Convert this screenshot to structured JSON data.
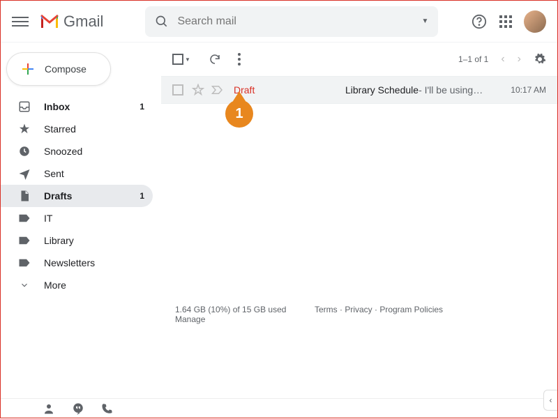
{
  "header": {
    "product": "Gmail",
    "search_placeholder": "Search mail"
  },
  "compose_label": "Compose",
  "sidebar": {
    "items": [
      {
        "label": "Inbox",
        "count": "1"
      },
      {
        "label": "Starred"
      },
      {
        "label": "Snoozed"
      },
      {
        "label": "Sent"
      },
      {
        "label": "Drafts",
        "count": "1"
      },
      {
        "label": "IT"
      },
      {
        "label": "Library"
      },
      {
        "label": "Newsletters"
      },
      {
        "label": "More"
      }
    ]
  },
  "toolbar": {
    "range": "1–1 of 1"
  },
  "message": {
    "sender": "Draft",
    "subject": "Library Schedule",
    "snippet": " - I'll be using…",
    "time": "10:17 AM"
  },
  "footer": {
    "storage": "1.64 GB (10%) of 15 GB used",
    "manage": "Manage",
    "links": "Terms · Privacy · Program Policies"
  },
  "callout": {
    "number": "1"
  }
}
